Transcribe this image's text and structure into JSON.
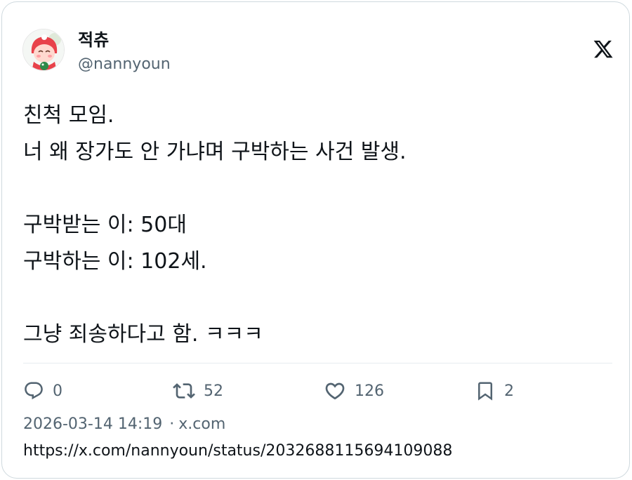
{
  "author": {
    "display_name": "적츄",
    "handle": "@nannyoun",
    "avatar_icon": "avatar-character-icon"
  },
  "platform": {
    "logo_icon": "x-logo-icon"
  },
  "tweet": {
    "lines": [
      "친척 모임.",
      "너 왜 장가도 안 가냐며 구박하는 사건 발생.",
      "",
      "구박받는 이: 50대",
      "구박하는 이: 102세.",
      "",
      "그냥 죄송하다고 함. ㅋㅋㅋ"
    ]
  },
  "actions": {
    "reply": {
      "icon": "reply-icon",
      "count": "0"
    },
    "retweet": {
      "icon": "retweet-icon",
      "count": "52"
    },
    "like": {
      "icon": "heart-icon",
      "count": "126"
    },
    "bookmark": {
      "icon": "bookmark-icon",
      "count": "2"
    }
  },
  "meta": {
    "timestamp": "2026-03-14 14:19",
    "separator": "·",
    "source": "x.com"
  },
  "url": "https://x.com/nannyoun/status/2032688115694109088",
  "colors": {
    "text": "#0f1419",
    "secondary": "#536471",
    "border": "#cfd9de",
    "divider": "#e6ecf0"
  }
}
